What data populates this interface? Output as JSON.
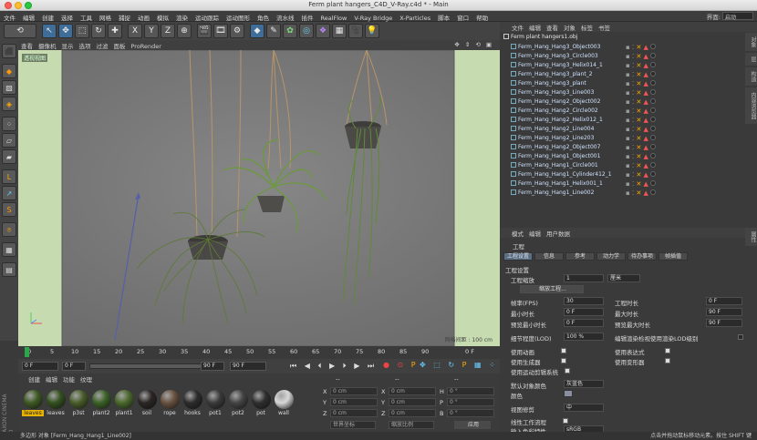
{
  "window": {
    "title": "Ferm plant hangers_C4D_V-Ray.c4d * - Main"
  },
  "menubar": {
    "items": [
      "文件",
      "编辑",
      "创建",
      "选择",
      "工具",
      "网格",
      "捕捉",
      "动画",
      "模拟",
      "渲染",
      "运动跟踪",
      "运动图形",
      "角色",
      "流水线",
      "插件",
      "RealFlow",
      "V-Ray Bridge",
      "X-Particles",
      "脚本",
      "窗口",
      "帮助"
    ],
    "layout_label": "界面:",
    "layout_value": "启动"
  },
  "viewport": {
    "menu": [
      "查看",
      "摄像机",
      "显示",
      "选项",
      "过滤",
      "面板",
      "ProRender"
    ],
    "label": "透视视图",
    "grid_spacing": "网格间距 : 100 cm"
  },
  "timeline": {
    "ticks": [
      "0",
      "5",
      "10",
      "15",
      "20",
      "25",
      "30",
      "35",
      "40",
      "45",
      "50",
      "55",
      "60",
      "65",
      "70",
      "75",
      "80",
      "85",
      "90"
    ],
    "end_label": "0 F"
  },
  "controls": {
    "start_frame": "0 F",
    "min_frame": "0 F",
    "max_frame": "90 F",
    "end_frame": "90 F"
  },
  "materials": {
    "menu": [
      "创建",
      "编辑",
      "功能",
      "纹理"
    ],
    "items": [
      {
        "label": "leaves",
        "color": "#3e5a23"
      },
      {
        "label": "leaves",
        "color": "#34511f"
      },
      {
        "label": "p3st",
        "color": "#4a5e2a"
      },
      {
        "label": "plant2",
        "color": "#3c6227"
      },
      {
        "label": "plant1",
        "color": "#4b6a2c"
      },
      {
        "label": "soil",
        "color": "#2a2624"
      },
      {
        "label": "rope",
        "color": "#6a5240"
      },
      {
        "label": "hooks",
        "color": "#2c2c2c"
      },
      {
        "label": "pot1",
        "color": "#3b3b3b"
      },
      {
        "label": "pot2",
        "color": "#454545"
      },
      {
        "label": "pot",
        "color": "#2f2f2f"
      },
      {
        "label": "wall",
        "color": "#d8d8d8"
      }
    ],
    "side_logo": "MAXON CINEMA 4D"
  },
  "coords": {
    "header": [
      "--",
      "--",
      "--"
    ],
    "rows": [
      {
        "a": "X",
        "av": "0 cm",
        "b": "X",
        "bv": "0 cm",
        "c": "H",
        "cv": "0 °"
      },
      {
        "a": "Y",
        "av": "0 cm",
        "b": "Y",
        "bv": "0 cm",
        "c": "P",
        "cv": "0 °"
      },
      {
        "a": "Z",
        "av": "0 cm",
        "b": "Z",
        "bv": "0 cm",
        "c": "B",
        "cv": "0 °"
      }
    ],
    "mode": "世界坐标",
    "scale": "缩放比例",
    "apply": "应用"
  },
  "status": {
    "text": "多边形 对象 [Ferm_Hang_Hang1_Line002]",
    "hint": "点击并拖动鼠标移动元素。按住 SHIFT 键"
  },
  "objects": {
    "menu": [
      "文件",
      "编辑",
      "查看",
      "对象",
      "标签",
      "书签"
    ],
    "root": "Ferm plant hangers1.obj",
    "items": [
      "Ferm_Hang_Hang3_Object003",
      "Ferm_Hang_Hang3_Circle003",
      "Ferm_Hang_Hang3_Helix014_1",
      "Ferm_Hang_Hang3_plant_2",
      "Ferm_Hang_Hang3_plant",
      "Ferm_Hang_Hang3_Line003",
      "Ferm_Hang_Hang2_Object002",
      "Ferm_Hang_Hang2_Circle002",
      "Ferm_Hang_Hang2_Helix012_1",
      "Ferm_Hang_Hang2_Line004",
      "Ferm_Hang_Hang2_Line203",
      "Ferm_Hang_Hang2_Object007",
      "Ferm_Hang_Hang1_Object001",
      "Ferm_Hang_Hang1_Circle001",
      "Ferm_Hang_Hang1_Cylinder412_1",
      "Ferm_Hang_Hang1_Helix001_1",
      "Ferm_Hang_Hang1_Line002"
    ]
  },
  "attributes": {
    "menu": [
      "模式",
      "编辑",
      "用户数据"
    ],
    "title": "工程",
    "tabs": [
      "工程设置",
      "信息",
      "参考",
      "动力学",
      "待办事项",
      "帧插值"
    ],
    "section": "工程设置",
    "scale_label": "工程缩放",
    "scale_value": "1",
    "scale_unit": "厘米",
    "scale_btn": "缩放工程...",
    "fps_label": "帧率(FPS)",
    "fps": "30",
    "duration_label": "工程时长",
    "duration": "0 F",
    "min_label": "最小时长",
    "min": "0 F",
    "max_label": "最大时长",
    "max": "90 F",
    "pmin_label": "预览最小时长",
    "pmin": "0 F",
    "pmax_label": "预览最大时长",
    "pmax": "90 F",
    "lod_label": "细节程度(LOD)",
    "lod": "100 %",
    "lod_render": "编辑渲染检视使用渲染LOD级别",
    "anim": "使用动画",
    "expr": "使用表达式",
    "gen": "使用生成器",
    "deform": "使用变形器",
    "motion": "使用运动剪辑系统",
    "default_color_label": "默认对象颜色",
    "default_color": "灰蓝色",
    "color_label": "颜色",
    "clip_label": "视图修剪",
    "clip": "中",
    "linear_label": "线性工作流程",
    "input_label": "输入色彩特性",
    "input": "sRGB"
  },
  "sidetabs": [
    "对象",
    "层",
    "构造",
    "内容浏览器",
    "属性"
  ]
}
